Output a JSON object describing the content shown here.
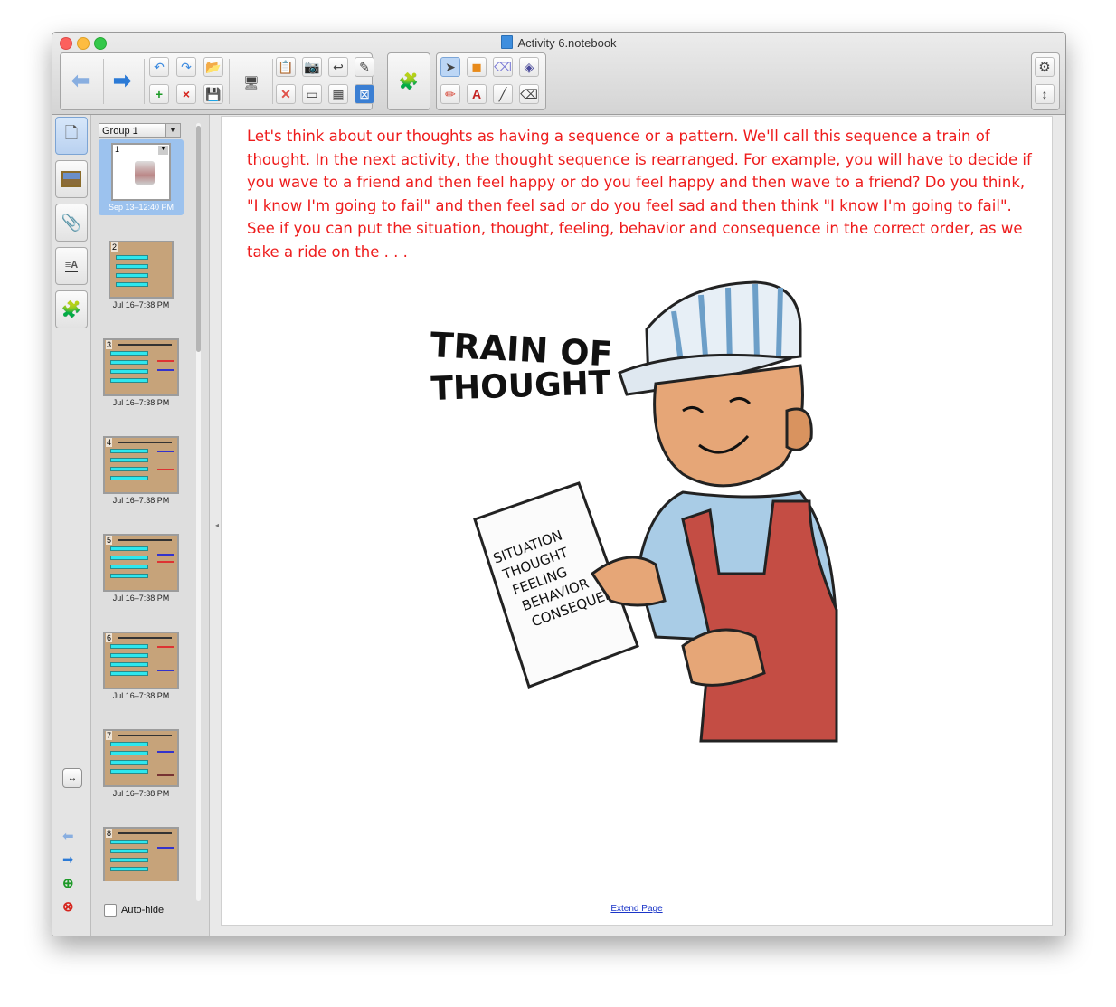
{
  "window": {
    "title": "Activity 6.notebook"
  },
  "toolbar": {
    "back_label": "⬅",
    "forward_label": "➡",
    "tools": [
      "undo-icon",
      "redo-icon",
      "open-icon",
      "add-page-icon",
      "delete-page-icon",
      "save-icon"
    ],
    "icons": {
      "undo": "↶",
      "redo": "↷",
      "open": "📂",
      "add_page": "+",
      "delete_page": "×",
      "save": "💾",
      "display": "🖥",
      "paste": "📋",
      "screen_capture": "📷",
      "undo_page": "↩",
      "pen": "✎",
      "delete": "✕",
      "screen_shade": "▭",
      "table": "▦",
      "fullscreen": "⊠",
      "addon": "🧩",
      "select": "➤",
      "shapes": "◼",
      "eraser": "⌫",
      "fill": "◈",
      "pens": "✏",
      "text": "A",
      "line": "╱",
      "eraser2": "⌫",
      "settings": "⚙",
      "resize": "↕"
    }
  },
  "sidebar_tabs": [
    "page-sorter",
    "gallery",
    "attachments",
    "properties",
    "addons"
  ],
  "sorter": {
    "group_label": "Group 1",
    "pages": [
      {
        "num": "1",
        "caption": "Sep 13–12:40 PM",
        "selected": true
      },
      {
        "num": "2",
        "caption": "Jul 16–7:38 PM"
      },
      {
        "num": "3",
        "caption": "Jul 16–7:38 PM"
      },
      {
        "num": "4",
        "caption": "Jul 16–7:38 PM"
      },
      {
        "num": "5",
        "caption": "Jul 16–7:38 PM"
      },
      {
        "num": "6",
        "caption": "Jul 16–7:38 PM"
      },
      {
        "num": "7",
        "caption": "Jul 16–7:38 PM"
      },
      {
        "num": "8",
        "caption": ""
      }
    ],
    "autohide_label": "Auto-hide"
  },
  "page": {
    "text": "Let's think about our thoughts as having a sequence or a pattern.  We'll call this sequence a train of thought.  In the next activity, the thought sequence is rearranged.  For example, you will have to decide if you wave to a friend and then feel happy or do you feel happy and then wave to a friend? Do you think, \"I know I'm going to fail\" and then feel sad or do you feel sad and then think \"I know I'm going to fail\".  See if you can put the situation, thought, feeling, behavior and consequence in the correct order, as we take a ride on the . . .",
    "illustration": {
      "title_line1": "TRAIN OF",
      "title_line2": "THOUGHT",
      "ticket_lines": [
        "SITUATION",
        "THOUGHT",
        "FEELING",
        "BEHAVIOR",
        "CONSEQUENCE"
      ]
    },
    "extend_label": "Extend Page"
  },
  "colors": {
    "text_red": "#ee1c1c",
    "accent_blue": "#2b7ad6",
    "cyan": "#2ee7ee"
  }
}
